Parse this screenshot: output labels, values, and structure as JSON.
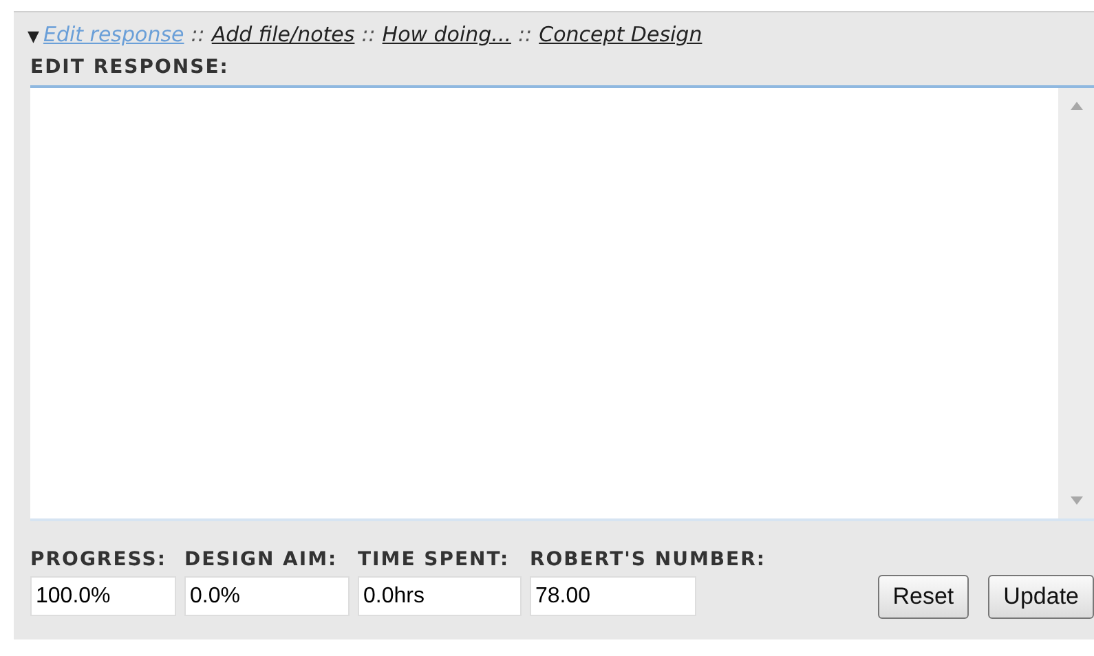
{
  "toggle": "▼",
  "breadcrumb": [
    {
      "label": "Edit response",
      "selected": true
    },
    {
      "label": "Add file/notes",
      "selected": false
    },
    {
      "label": "How doing...",
      "selected": false
    },
    {
      "label": "Concept Design",
      "selected": false
    }
  ],
  "separator": "::",
  "section_title": "EDIT RESPONSE:",
  "fields": [
    {
      "label": "PROGRESS:",
      "value": "100.0%"
    },
    {
      "label": "DESIGN AIM:",
      "value": "0.0%"
    },
    {
      "label": "TIME SPENT:",
      "value": "0.0hrs"
    },
    {
      "label": "ROBERT'S NUMBER:",
      "value": "78.00"
    }
  ],
  "buttons": [
    "Reset",
    "Update"
  ]
}
